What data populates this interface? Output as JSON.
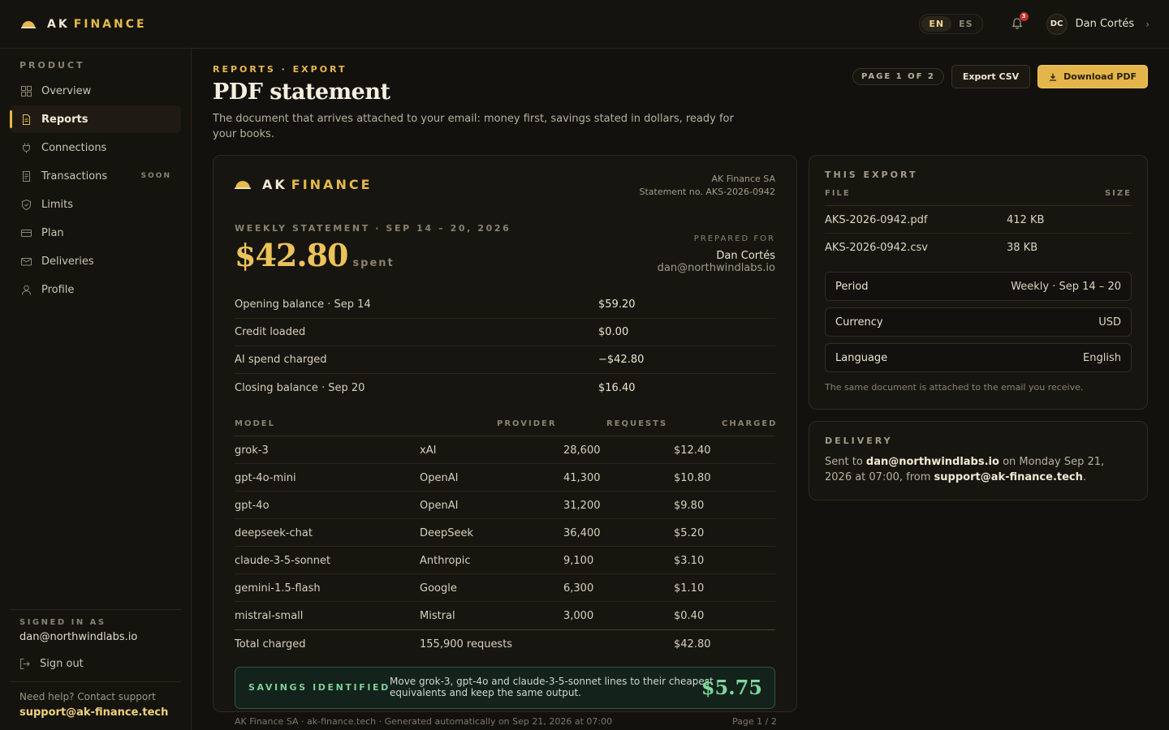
{
  "brand": {
    "ak": "AK",
    "finance": "FINANCE"
  },
  "header": {
    "languages": [
      "EN",
      "ES"
    ],
    "active_language": "EN",
    "notifications_count": "3",
    "user_initials": "DC",
    "user_name": "Dan Cortés"
  },
  "sidebar": {
    "section": "PRODUCT",
    "items": [
      {
        "label": "Overview",
        "icon": "grid-icon"
      },
      {
        "label": "Reports",
        "icon": "document-icon",
        "active": true
      },
      {
        "label": "Connections",
        "icon": "plug-icon"
      },
      {
        "label": "Transactions",
        "icon": "receipt-icon",
        "badge": "SOON"
      },
      {
        "label": "Limits",
        "icon": "shield-icon"
      },
      {
        "label": "Plan",
        "icon": "card-icon"
      },
      {
        "label": "Deliveries",
        "icon": "mail-icon"
      },
      {
        "label": "Profile",
        "icon": "user-icon"
      }
    ],
    "signed_in_label": "SIGNED IN AS",
    "signed_in_email": "dan@northwindlabs.io",
    "sign_out": "Sign out",
    "help_text": "Need help? Contact support",
    "help_email": "support@ak-finance.tech"
  },
  "page": {
    "breadcrumb": "REPORTS · EXPORT",
    "title": "PDF statement",
    "description": "The document that arrives attached to your email: money first, savings stated in dollars, ready for your books.",
    "page_indicator": "PAGE 1 OF 2",
    "export_csv": "Export CSV",
    "download_pdf": "Download PDF"
  },
  "statement": {
    "company": "AK Finance SA",
    "statement_no": "Statement no. AKS-2026-0942",
    "period": "WEEKLY STATEMENT · SEP 14 – 20, 2026",
    "amount": "$42.80",
    "amount_unit": "spent",
    "prepared_for_label": "PREPARED FOR",
    "prepared_for_name": "Dan Cortés",
    "prepared_for_email": "dan@northwindlabs.io",
    "balances": [
      {
        "label": "Opening balance · Sep 14",
        "value": "$59.20"
      },
      {
        "label": "Credit loaded",
        "value": "$0.00"
      },
      {
        "label": "AI spend charged",
        "value": "−$42.80"
      },
      {
        "label": "Closing balance · Sep 20",
        "value": "$16.40"
      }
    ],
    "columns": [
      "MODEL",
      "PROVIDER",
      "REQUESTS",
      "CHARGED"
    ],
    "rows": [
      {
        "model": "grok-3",
        "provider": "xAI",
        "requests": "28,600",
        "charged": "$12.40"
      },
      {
        "model": "gpt-4o-mini",
        "provider": "OpenAI",
        "requests": "41,300",
        "charged": "$10.80"
      },
      {
        "model": "gpt-4o",
        "provider": "OpenAI",
        "requests": "31,200",
        "charged": "$9.80"
      },
      {
        "model": "deepseek-chat",
        "provider": "DeepSeek",
        "requests": "36,400",
        "charged": "$5.20"
      },
      {
        "model": "claude-3-5-sonnet",
        "provider": "Anthropic",
        "requests": "9,100",
        "charged": "$3.10"
      },
      {
        "model": "gemini-1.5-flash",
        "provider": "Google",
        "requests": "6,300",
        "charged": "$1.10"
      },
      {
        "model": "mistral-small",
        "provider": "Mistral",
        "requests": "3,000",
        "charged": "$0.40"
      }
    ],
    "total_label": "Total charged",
    "total_requests": "155,900 requests",
    "total_charged": "$42.80",
    "savings_label": "SAVINGS IDENTIFIED",
    "savings_text": "Move grok-3, gpt-4o and claude-3-5-sonnet lines to their cheapest equivalents and keep the same output.",
    "savings_value": "$5.75",
    "footer": "AK Finance SA · ak-finance.tech · Generated automatically on Sep 21, 2026 at 07:00",
    "footer_page": "Page 1 / 2"
  },
  "export": {
    "title": "THIS EXPORT",
    "col_file": "FILE",
    "col_size": "SIZE",
    "files": [
      {
        "name": "AKS-2026-0942.pdf",
        "size": "412 KB"
      },
      {
        "name": "AKS-2026-0942.csv",
        "size": "38 KB"
      }
    ],
    "settings": [
      {
        "label": "Period",
        "value": "Weekly · Sep 14 – 20"
      },
      {
        "label": "Currency",
        "value": "USD"
      },
      {
        "label": "Language",
        "value": "English"
      }
    ],
    "note": "The same document is attached to the email you receive."
  },
  "delivery": {
    "title": "DELIVERY",
    "prefix": "Sent to ",
    "email": "dan@northwindlabs.io",
    "middle": " on Monday Sep 21, 2026 at 07:00, from ",
    "from": "support@ak-finance.tech",
    "suffix": "."
  },
  "colors": {
    "accent": "#e6b94c",
    "savings": "#7dd89f",
    "background": "#13110d"
  }
}
